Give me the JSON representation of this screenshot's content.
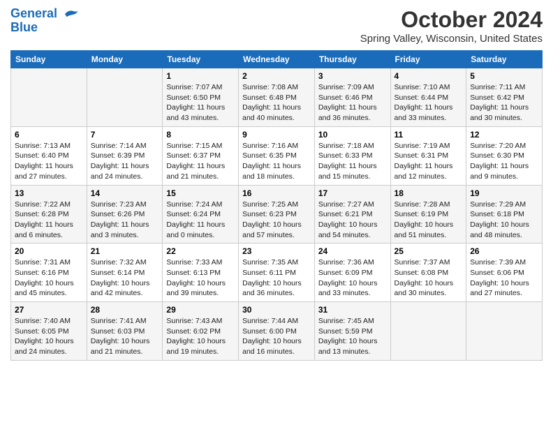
{
  "header": {
    "logo_line1": "General",
    "logo_line2": "Blue",
    "month_title": "October 2024",
    "location": "Spring Valley, Wisconsin, United States"
  },
  "weekdays": [
    "Sunday",
    "Monday",
    "Tuesday",
    "Wednesday",
    "Thursday",
    "Friday",
    "Saturday"
  ],
  "weeks": [
    [
      {
        "day": "",
        "info": ""
      },
      {
        "day": "",
        "info": ""
      },
      {
        "day": "1",
        "info": "Sunrise: 7:07 AM\nSunset: 6:50 PM\nDaylight: 11 hours and 43 minutes."
      },
      {
        "day": "2",
        "info": "Sunrise: 7:08 AM\nSunset: 6:48 PM\nDaylight: 11 hours and 40 minutes."
      },
      {
        "day": "3",
        "info": "Sunrise: 7:09 AM\nSunset: 6:46 PM\nDaylight: 11 hours and 36 minutes."
      },
      {
        "day": "4",
        "info": "Sunrise: 7:10 AM\nSunset: 6:44 PM\nDaylight: 11 hours and 33 minutes."
      },
      {
        "day": "5",
        "info": "Sunrise: 7:11 AM\nSunset: 6:42 PM\nDaylight: 11 hours and 30 minutes."
      }
    ],
    [
      {
        "day": "6",
        "info": "Sunrise: 7:13 AM\nSunset: 6:40 PM\nDaylight: 11 hours and 27 minutes."
      },
      {
        "day": "7",
        "info": "Sunrise: 7:14 AM\nSunset: 6:39 PM\nDaylight: 11 hours and 24 minutes."
      },
      {
        "day": "8",
        "info": "Sunrise: 7:15 AM\nSunset: 6:37 PM\nDaylight: 11 hours and 21 minutes."
      },
      {
        "day": "9",
        "info": "Sunrise: 7:16 AM\nSunset: 6:35 PM\nDaylight: 11 hours and 18 minutes."
      },
      {
        "day": "10",
        "info": "Sunrise: 7:18 AM\nSunset: 6:33 PM\nDaylight: 11 hours and 15 minutes."
      },
      {
        "day": "11",
        "info": "Sunrise: 7:19 AM\nSunset: 6:31 PM\nDaylight: 11 hours and 12 minutes."
      },
      {
        "day": "12",
        "info": "Sunrise: 7:20 AM\nSunset: 6:30 PM\nDaylight: 11 hours and 9 minutes."
      }
    ],
    [
      {
        "day": "13",
        "info": "Sunrise: 7:22 AM\nSunset: 6:28 PM\nDaylight: 11 hours and 6 minutes."
      },
      {
        "day": "14",
        "info": "Sunrise: 7:23 AM\nSunset: 6:26 PM\nDaylight: 11 hours and 3 minutes."
      },
      {
        "day": "15",
        "info": "Sunrise: 7:24 AM\nSunset: 6:24 PM\nDaylight: 11 hours and 0 minutes."
      },
      {
        "day": "16",
        "info": "Sunrise: 7:25 AM\nSunset: 6:23 PM\nDaylight: 10 hours and 57 minutes."
      },
      {
        "day": "17",
        "info": "Sunrise: 7:27 AM\nSunset: 6:21 PM\nDaylight: 10 hours and 54 minutes."
      },
      {
        "day": "18",
        "info": "Sunrise: 7:28 AM\nSunset: 6:19 PM\nDaylight: 10 hours and 51 minutes."
      },
      {
        "day": "19",
        "info": "Sunrise: 7:29 AM\nSunset: 6:18 PM\nDaylight: 10 hours and 48 minutes."
      }
    ],
    [
      {
        "day": "20",
        "info": "Sunrise: 7:31 AM\nSunset: 6:16 PM\nDaylight: 10 hours and 45 minutes."
      },
      {
        "day": "21",
        "info": "Sunrise: 7:32 AM\nSunset: 6:14 PM\nDaylight: 10 hours and 42 minutes."
      },
      {
        "day": "22",
        "info": "Sunrise: 7:33 AM\nSunset: 6:13 PM\nDaylight: 10 hours and 39 minutes."
      },
      {
        "day": "23",
        "info": "Sunrise: 7:35 AM\nSunset: 6:11 PM\nDaylight: 10 hours and 36 minutes."
      },
      {
        "day": "24",
        "info": "Sunrise: 7:36 AM\nSunset: 6:09 PM\nDaylight: 10 hours and 33 minutes."
      },
      {
        "day": "25",
        "info": "Sunrise: 7:37 AM\nSunset: 6:08 PM\nDaylight: 10 hours and 30 minutes."
      },
      {
        "day": "26",
        "info": "Sunrise: 7:39 AM\nSunset: 6:06 PM\nDaylight: 10 hours and 27 minutes."
      }
    ],
    [
      {
        "day": "27",
        "info": "Sunrise: 7:40 AM\nSunset: 6:05 PM\nDaylight: 10 hours and 24 minutes."
      },
      {
        "day": "28",
        "info": "Sunrise: 7:41 AM\nSunset: 6:03 PM\nDaylight: 10 hours and 21 minutes."
      },
      {
        "day": "29",
        "info": "Sunrise: 7:43 AM\nSunset: 6:02 PM\nDaylight: 10 hours and 19 minutes."
      },
      {
        "day": "30",
        "info": "Sunrise: 7:44 AM\nSunset: 6:00 PM\nDaylight: 10 hours and 16 minutes."
      },
      {
        "day": "31",
        "info": "Sunrise: 7:45 AM\nSunset: 5:59 PM\nDaylight: 10 hours and 13 minutes."
      },
      {
        "day": "",
        "info": ""
      },
      {
        "day": "",
        "info": ""
      }
    ]
  ]
}
